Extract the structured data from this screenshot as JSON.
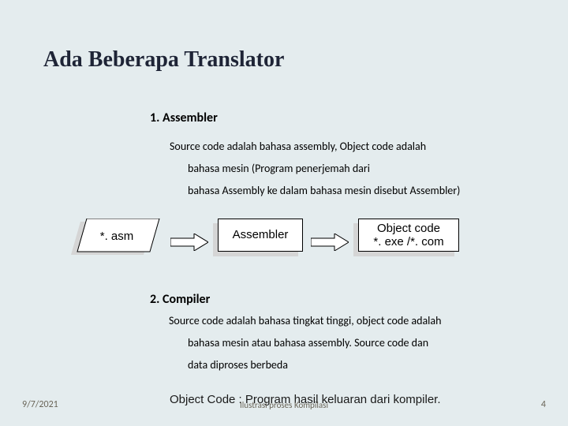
{
  "title": "Ada Beberapa Translator",
  "section1": {
    "heading": "1. Assembler",
    "line1": "Source code adalah bahasa assembly, Object code adalah",
    "line2": "bahasa mesin (Program penerjemah dari",
    "line3": "bahasa Assembly ke dalam bahasa mesin disebut Assembler)"
  },
  "diagram": {
    "input": "*. asm",
    "process": "Assembler",
    "output_line1": "Object code",
    "output_line2": "*. exe /*. com"
  },
  "section2": {
    "heading": "2. Compiler",
    "line1": "Source code adalah bahasa tingkat tinggi, object code adalah",
    "line2": "bahasa mesin atau bahasa assembly. Source code dan",
    "line3": "data diproses berbeda"
  },
  "object_code_line": "Object Code    : Program hasil keluaran dari kompiler.",
  "footer": {
    "date": "9/7/2021",
    "center": "Ilustrasi proses Kompilasi",
    "page": "4"
  }
}
